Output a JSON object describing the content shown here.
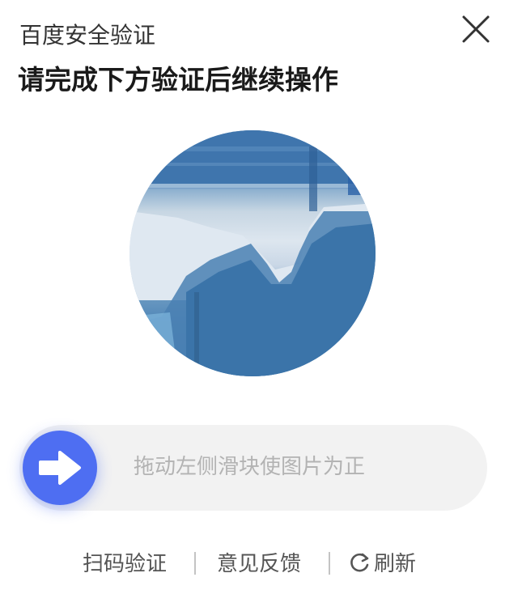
{
  "header": {
    "subtitle": "百度安全验证",
    "title": "请完成下方验证后继续操作"
  },
  "icons": {
    "close": "close-icon",
    "arrow": "arrow-right-icon",
    "refresh": "refresh-icon"
  },
  "slider": {
    "hint": "拖动左侧滑块使图片为正",
    "position": 0
  },
  "footer": {
    "scan_label": "扫码验证",
    "feedback_label": "意见反馈",
    "refresh_label": "刷新"
  },
  "colors": {
    "accent": "#4e6ef2",
    "track": "#f2f2f2",
    "hint": "#b3b3b3"
  }
}
